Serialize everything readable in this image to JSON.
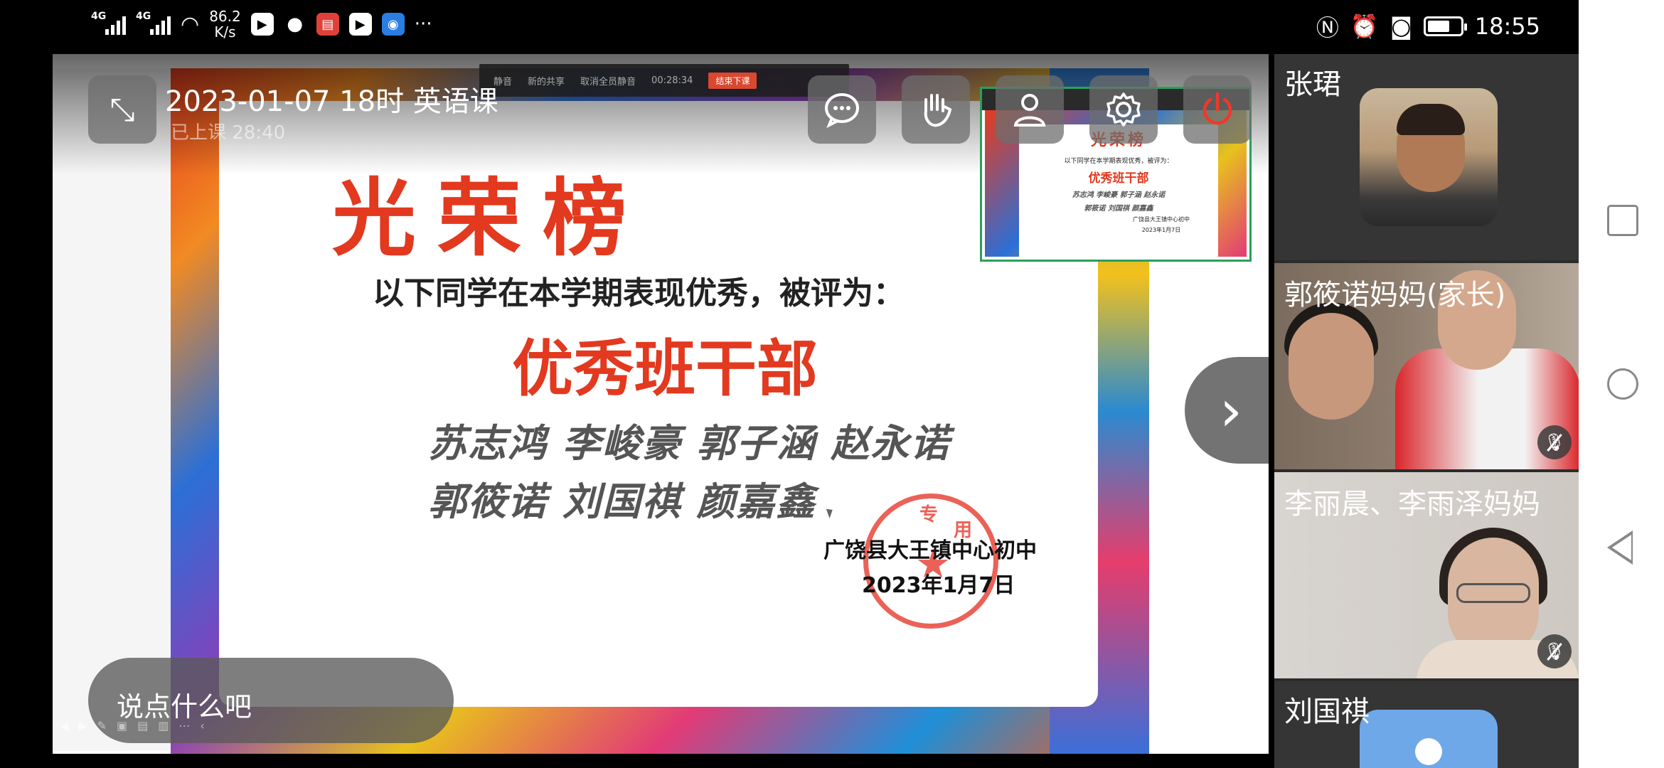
{
  "status_bar": {
    "signal1": "4G",
    "signal2": "4G",
    "speed_value": "86.2",
    "speed_unit": "K/s",
    "more": "···",
    "time": "18:55",
    "icons": [
      "nfc-icon",
      "alarm-icon",
      "camera-icon",
      "battery-icon"
    ]
  },
  "meeting": {
    "title": "2023-01-07 18时 英语课",
    "status": "已上课  28:40",
    "toolbar_strip": {
      "mute": "静音",
      "share": "新的共享",
      "mute_all": "取消全员静音",
      "timer": "00:28:34",
      "end": "结束下课"
    }
  },
  "slide": {
    "heading": "光荣榜",
    "subtitle": "以下同学在本学期表现优秀，被评为：",
    "award": "优秀班干部",
    "names_line1": "苏志鸿 李峻豪 郭子涵 赵永诺",
    "names_line2": "郭筱诺 刘国祺 颜嘉鑫",
    "school": "广饶县大王镇中心初中",
    "date": "2023年1月7日",
    "seal_chars": [
      "专",
      "用"
    ]
  },
  "thumbnail": {
    "heading": "光荣榜",
    "subtitle": "以下同学在本学期表现优秀，被评为：",
    "award": "优秀班干部",
    "names_line1": "苏志鸿 李峻豪 郭子涵 赵永诺",
    "names_line2": "郭筱诺 刘国祺 颜嘉鑫",
    "school": "广饶县大王镇中心初中",
    "date": "2023年1月7日"
  },
  "chat": {
    "placeholder": "说点什么吧"
  },
  "participants": [
    {
      "name": "张珺",
      "muted": false
    },
    {
      "name": "郭筱诺妈妈(家长)",
      "muted": true
    },
    {
      "name": "李丽晨、李雨泽妈妈",
      "muted": true
    },
    {
      "name": "刘国祺",
      "muted": false
    }
  ]
}
